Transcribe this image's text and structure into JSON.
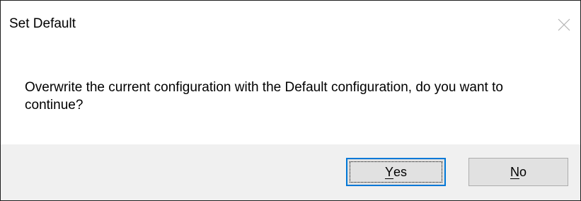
{
  "window": {
    "title": "Set Default",
    "close_icon": "close-icon"
  },
  "message": {
    "text": "Overwrite the current configuration with the Default configuration, do you want to continue?"
  },
  "buttons": {
    "yes": {
      "mnemonic": "Y",
      "rest": "es",
      "is_default": true
    },
    "no": {
      "mnemonic": "N",
      "rest": "o",
      "is_default": false
    }
  },
  "colors": {
    "default_button_border": "#0078d7",
    "footer_background": "#f0f0f0",
    "button_face": "#e1e1e1"
  }
}
